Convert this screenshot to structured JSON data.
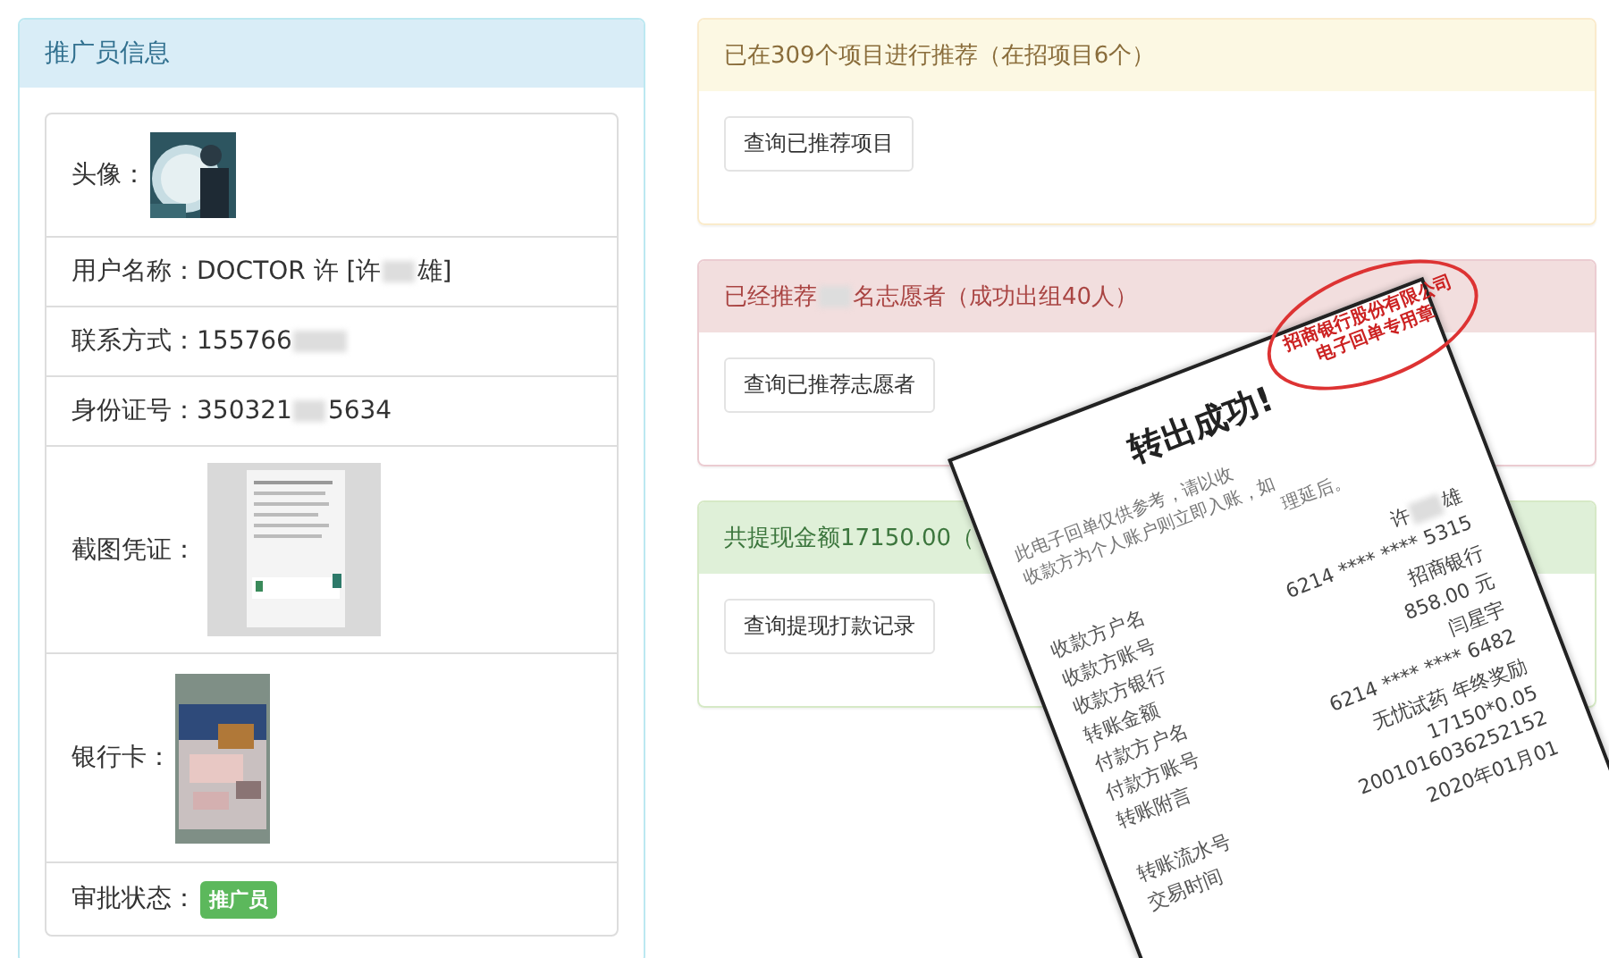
{
  "info_panel": {
    "title": "推广员信息",
    "rows": [
      {
        "kind": "avatar",
        "label": "头像："
      },
      {
        "kind": "text",
        "label": "用户名称：",
        "parts": [
          "DOCTOR 许  [许",
          "雄]"
        ]
      },
      {
        "kind": "text",
        "label": "联系方式：",
        "parts": [
          "155766"
        ],
        "trailing_redaction": true
      },
      {
        "kind": "text",
        "label": "身份证号：",
        "parts": [
          "350321",
          "5634"
        ]
      },
      {
        "kind": "screenshot",
        "label": "截图凭证："
      },
      {
        "kind": "bankcard",
        "label": "银行卡："
      },
      {
        "kind": "badge",
        "label": "审批状态：",
        "badge": "推广员"
      }
    ]
  },
  "panels": [
    {
      "kind": "warning",
      "title_parts": [
        "已在309个项目进行推荐（在招项目6个）"
      ],
      "button": "查询已推荐项目"
    },
    {
      "kind": "danger",
      "title_parts": [
        "已经推荐",
        "名志愿者（成功出组40人）"
      ],
      "button": "查询已推荐志愿者"
    },
    {
      "kind": "success",
      "title_parts": [
        "共提现金额17150.00（"
      ],
      "button": "查询提现打款记录"
    }
  ],
  "receipt": {
    "title": "转出成功!",
    "stamp": [
      "招商银行股份有限公司",
      "电子回单专用章"
    ],
    "notes": [
      "此电子回单仅供参考，请以收",
      "收款方为个人账户则立即入账，如",
      "理延后。"
    ],
    "rows": [
      {
        "label": "收款方户名",
        "value": [
          "许",
          "雄"
        ]
      },
      {
        "label": "收款方账号",
        "value": [
          "6214 **** **** 5315"
        ]
      },
      {
        "label": "收款方银行",
        "value": [
          "招商银行"
        ]
      },
      {
        "label": "转账金额",
        "value": [
          "858.00 元"
        ]
      },
      {
        "label": "付款方户名",
        "value": [
          "闫星宇"
        ]
      },
      {
        "label": "付款方账号",
        "value": [
          "6214 **** **** 6482"
        ]
      },
      {
        "label": "转账附言",
        "value": [
          "无忧试药 年终奖励"
        ]
      },
      {
        "value": [
          "17150*0.05"
        ]
      },
      {
        "label": "转账流水号",
        "value": [
          "2001016036252152"
        ]
      },
      {
        "label": "交易时间",
        "value": [
          "2020年01月01"
        ]
      }
    ]
  }
}
